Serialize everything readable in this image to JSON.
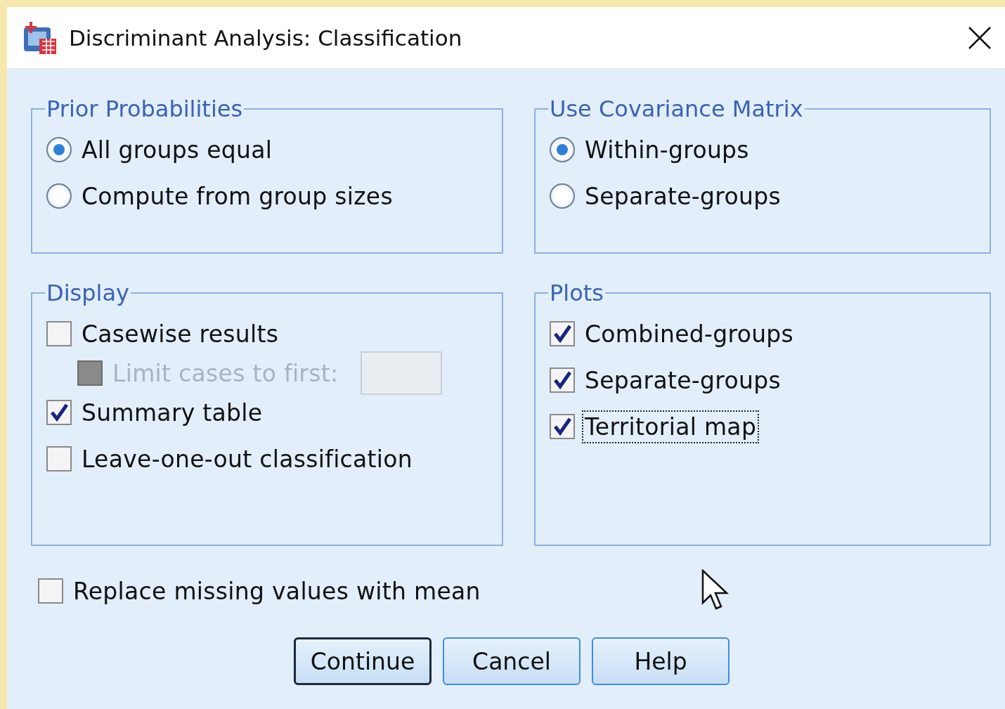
{
  "window": {
    "title": "Discriminant Analysis: Classification"
  },
  "groups": [
    {
      "title": "Prior Probabilities",
      "options": [
        {
          "kind": "radio",
          "label": "All groups equal",
          "selected": true
        },
        {
          "kind": "radio",
          "label": "Compute from group sizes",
          "selected": false
        }
      ]
    },
    {
      "title": "Use Covariance Matrix",
      "options": [
        {
          "kind": "radio",
          "label": "Within-groups",
          "selected": true
        },
        {
          "kind": "radio",
          "label": "Separate-groups",
          "selected": false
        }
      ]
    },
    {
      "title": "Display",
      "options": [
        {
          "kind": "checkbox",
          "label": "Casewise results",
          "checked": false,
          "children": [
            {
              "kind": "count",
              "label": "Limit cases to first:",
              "checked": false,
              "disabled": true
            }
          ]
        },
        {
          "kind": "checkbox",
          "label": "Summary table",
          "checked": true
        },
        {
          "kind": "checkbox",
          "label": "Leave-one-out classification",
          "checked": false
        }
      ]
    },
    {
      "title": "Plots",
      "options": [
        {
          "kind": "checkbox",
          "label": "Combined-groups",
          "checked": true
        },
        {
          "kind": "checkbox",
          "label": "Separate-groups",
          "checked": true
        },
        {
          "kind": "checkbox",
          "label": "Territorial map",
          "checked": true,
          "focused": true
        }
      ]
    }
  ],
  "replace_missing": {
    "label": "Replace missing values with mean",
    "checked": false
  },
  "buttons": [
    {
      "label": "Continue",
      "focused": true
    },
    {
      "label": "Cancel",
      "focused": false
    },
    {
      "label": "Help",
      "focused": false
    }
  ]
}
